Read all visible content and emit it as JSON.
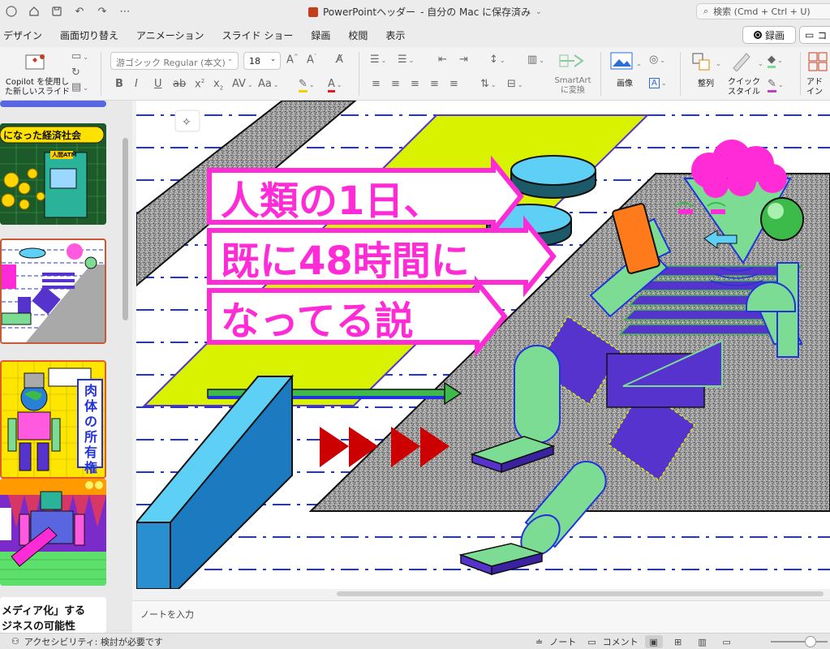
{
  "titlebar": {
    "doc_name": "PowerPointヘッダー",
    "save_status": "- 自分の Mac に保存済み",
    "search_placeholder": "検索 (Cmd + Ctrl + U)"
  },
  "menu": {
    "items": [
      "デザイン",
      "画面切り替え",
      "アニメーション",
      "スライド ショー",
      "録画",
      "校閲",
      "表示"
    ]
  },
  "actions": {
    "record_label": "録画",
    "comment_label": "コ"
  },
  "ribbon": {
    "copilot_line1": "Copilot を使用し",
    "copilot_line2": "た新しいスライド",
    "font_name": "游ゴシック Regular (本文)",
    "font_size": "18",
    "smartart_line1": "SmartArt",
    "smartart_line2": "に変換",
    "picture_label": "画像",
    "arrange_label": "整列",
    "quickstyle_line1": "クイック",
    "quickstyle_line2": "スタイル",
    "addin_line1": "アド",
    "addin_line2": "イン"
  },
  "thumbnails": {
    "slide1_title": "になった経済社会",
    "slide1_atm": "人間ATM",
    "slide3_title": "肉体の所有権",
    "slide5_line1": "メディア化」する",
    "slide5_line2": "ジネスの可能性"
  },
  "slide": {
    "headline_line1": "人類の1日、",
    "headline_line2": "既に48時間に",
    "headline_line3": "なってる説",
    "colors": {
      "magenta": "#ff2bd6",
      "lime": "#d8f200",
      "mint": "#7ddc93",
      "purple": "#5533cc",
      "cyan": "#5fd0f5",
      "red": "#cc0000",
      "blue_dash": "#2233dd"
    }
  },
  "notes": {
    "placeholder": "ノートを入力"
  },
  "status": {
    "accessibility": "アクセシビリティ: 検討が必要です",
    "notes_label": "ノート",
    "comments_label": "コメント"
  },
  "icons": [
    "sidebar-icon",
    "home-icon",
    "save-icon",
    "undo-icon",
    "redo-icon",
    "more-icon",
    "search-icon",
    "record-icon",
    "comment-icon",
    "accessibility-icon",
    "notes-icon",
    "comment-bubble-icon",
    "normal-view-icon",
    "grid-view-icon",
    "reading-view-icon",
    "slideshow-icon"
  ]
}
